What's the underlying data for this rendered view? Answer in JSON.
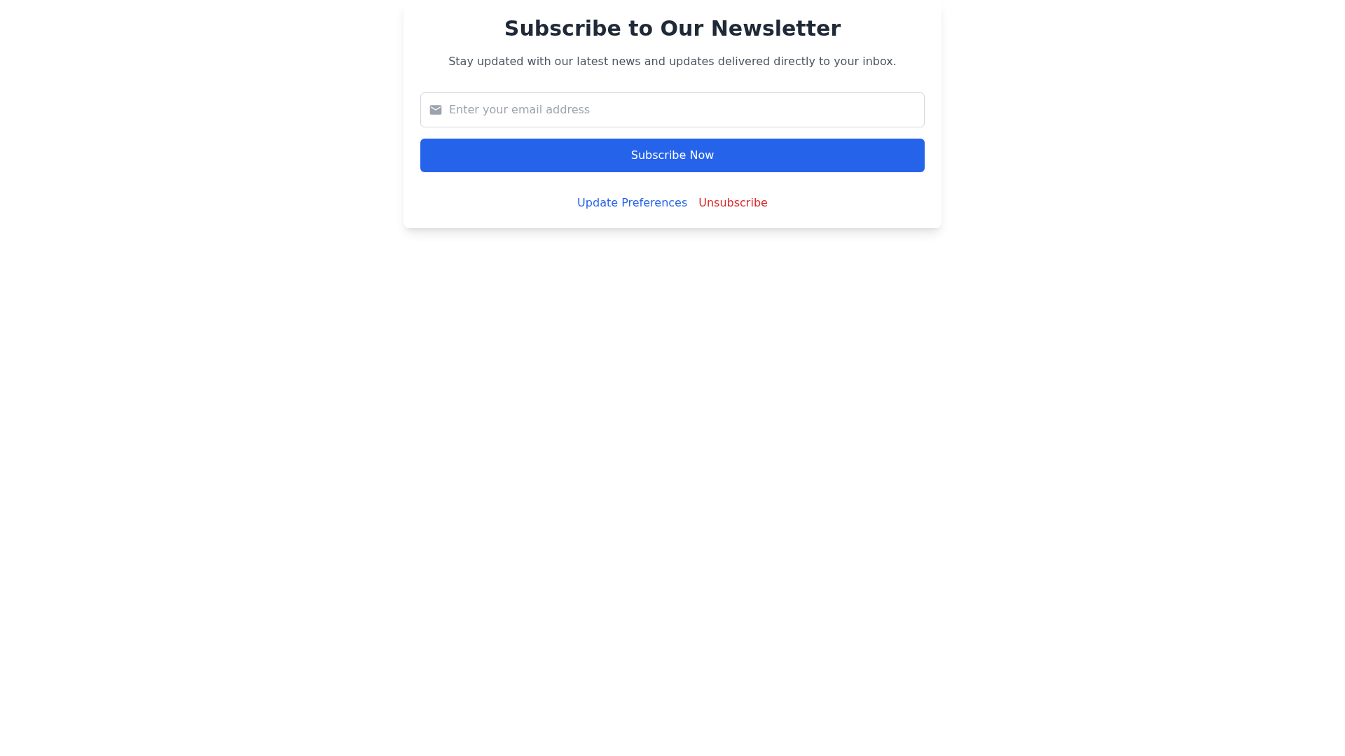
{
  "title": "Subscribe to Our Newsletter",
  "subtitle": "Stay updated with our latest news and updates delivered directly to your inbox.",
  "email_field": {
    "placeholder": "Enter your email address"
  },
  "subscribe_button": "Subscribe Now",
  "links": [
    {
      "label": "Update Preferences",
      "kind": "primary"
    },
    {
      "label": "Unsubscribe",
      "kind": "danger"
    }
  ]
}
